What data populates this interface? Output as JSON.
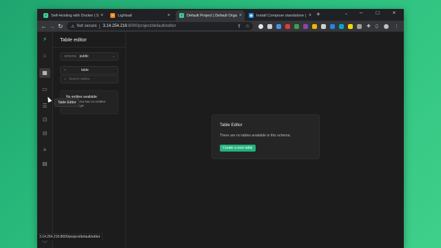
{
  "browser": {
    "tabs": [
      {
        "title": "Self-Hosting with Docker | Supa",
        "favicon": "supabase-favicon",
        "active": false
      },
      {
        "title": "Lightsail",
        "favicon": "lightsail-favicon",
        "active": false
      },
      {
        "title": "Default Project | Default Organiza",
        "favicon": "supabase-favicon",
        "active": true
      },
      {
        "title": "Install Compose standalone | Do",
        "favicon": "docker-favicon",
        "active": false
      }
    ],
    "new_tab_icon": "+",
    "address": {
      "security_label": "Not secure",
      "host": "3.14.254.216",
      "path": ":8000/project/default/editor"
    },
    "status_url": "3.14.254.216:8000/project/default/editor"
  },
  "sidebar": {
    "title": "Table editor",
    "schema_label": "schema",
    "schema_value": "public",
    "new_table_fragment": "table",
    "search_placeholder": "Search tables",
    "tooltip": "Table Editor",
    "empty_title": "No entities available",
    "empty_desc": "This schema has no entities available yet"
  },
  "main": {
    "card_title": "Table Editor",
    "card_message": "There are no tables available in this schema.",
    "create_button": "Create a new table"
  },
  "colors": {
    "accent": "#24b47e",
    "background": "#1c1c1c",
    "desktop": "#2bbf7e"
  }
}
